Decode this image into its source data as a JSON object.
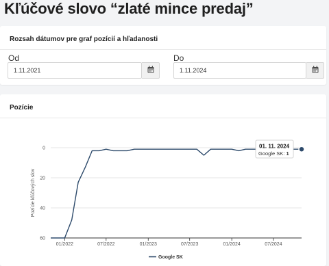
{
  "page": {
    "title": "Kľúčové slovo “zlaté mince predaj”"
  },
  "date_range": {
    "title": "Rozsah dátumov pre graf pozícií a hľadanosti",
    "from": {
      "label": "Od",
      "value": "1.11.2021",
      "icon": "calendar-icon"
    },
    "to": {
      "label": "Do",
      "value": "1.11.2024",
      "icon": "calendar-icon"
    }
  },
  "positions": {
    "title": "Pozície",
    "tooltip": {
      "date": "01. 11. 2024",
      "series": "Google SK",
      "value": "1"
    }
  },
  "colors": {
    "line": "#2d4a6b",
    "grid": "#e5e5e5",
    "axis": "#333333"
  },
  "chart_data": {
    "type": "line",
    "title": "",
    "xlabel": "",
    "ylabel": "Pozície kľúčových slov",
    "ylim": [
      60,
      0
    ],
    "y_reversed": true,
    "yticks": [
      0,
      20,
      40,
      60
    ],
    "xticks": [
      "01/2022",
      "07/2022",
      "01/2023",
      "07/2023",
      "01/2024",
      "07/2024"
    ],
    "xtick_dates": [
      "2022-01-01",
      "2022-07-01",
      "2023-01-01",
      "2023-07-01",
      "2024-01-01",
      "2024-07-01"
    ],
    "xlim": [
      "2021-11-01",
      "2024-11-01"
    ],
    "legend": "bottom",
    "grid": true,
    "series": [
      {
        "name": "Google SK",
        "x": [
          "2021-11-01",
          "2021-12-01",
          "2022-01-01",
          "2022-02-01",
          "2022-03-01",
          "2022-04-01",
          "2022-05-01",
          "2022-06-01",
          "2022-07-01",
          "2022-08-01",
          "2022-09-01",
          "2022-10-01",
          "2022-11-01",
          "2022-12-01",
          "2023-01-01",
          "2023-02-01",
          "2023-03-01",
          "2023-04-01",
          "2023-05-01",
          "2023-06-01",
          "2023-07-01",
          "2023-08-01",
          "2023-09-01",
          "2023-10-01",
          "2023-11-01",
          "2023-12-01",
          "2024-01-01",
          "2024-02-01",
          "2024-03-01",
          "2024-04-01",
          "2024-05-01",
          "2024-06-01",
          "2024-07-01",
          "2024-08-01",
          "2024-09-01",
          "2024-10-01",
          "2024-11-01"
        ],
        "y": [
          60,
          60,
          60,
          48,
          23,
          13,
          2,
          2,
          1,
          2,
          2,
          2,
          1,
          1,
          1,
          1,
          1,
          1,
          1,
          1,
          1,
          1,
          5,
          1,
          1,
          1,
          1,
          2,
          1,
          1,
          1,
          2,
          1,
          1,
          1,
          1,
          1
        ]
      }
    ]
  }
}
